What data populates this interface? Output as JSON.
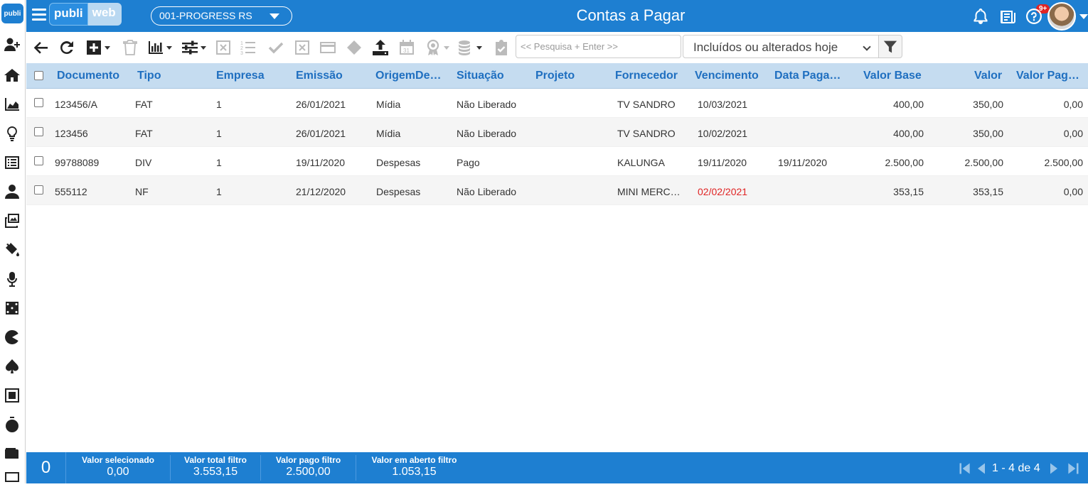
{
  "app": {
    "logo_mini": "publi",
    "brand_left": "publi",
    "brand_right": "web",
    "company": "001-PROGRESS RS",
    "title": "Contas a Pagar",
    "notification_badge": "9+"
  },
  "sidebar": {
    "items": [
      "add-user-icon",
      "home-icon",
      "chart-area-icon",
      "lightbulb-icon",
      "list-icon",
      "user-tie-icon",
      "photo-video-icon",
      "paint-bucket-icon",
      "microphone-icon",
      "dice-icon",
      "pacman-icon",
      "spade-icon",
      "square-icon",
      "stopwatch-icon",
      "wallet-icon",
      "monitor-icon"
    ]
  },
  "toolbar": {
    "search_placeholder": "<< Pesquisa + Enter >>",
    "filter_value": "Incluídos ou alterados hoje"
  },
  "table": {
    "columns": [
      "Documento",
      "Tipo",
      "Empresa",
      "Emissão",
      "OrigemDe…",
      "Situação",
      "Projeto",
      "Fornecedor",
      "Vencimento",
      "Data Paga…",
      "Valor Base",
      "Valor",
      "Valor Pag…"
    ],
    "rows": [
      {
        "documento": "123456/A",
        "tipo": "FAT",
        "empresa": "1",
        "emissao": "26/01/2021",
        "origem": "Mídia",
        "situacao": "Não Liberado",
        "projeto": "",
        "fornecedor": "TV SANDRO",
        "vencimento": "10/03/2021",
        "data_pagamento": "",
        "valor_base": "400,00",
        "valor": "350,00",
        "valor_pago": "0,00",
        "overdue": false
      },
      {
        "documento": "123456",
        "tipo": "FAT",
        "empresa": "1",
        "emissao": "26/01/2021",
        "origem": "Mídia",
        "situacao": "Não Liberado",
        "projeto": "",
        "fornecedor": "TV SANDRO",
        "vencimento": "10/02/2021",
        "data_pagamento": "",
        "valor_base": "400,00",
        "valor": "350,00",
        "valor_pago": "0,00",
        "overdue": false
      },
      {
        "documento": "99788089",
        "tipo": "DIV",
        "empresa": "1",
        "emissao": "19/11/2020",
        "origem": "Despesas",
        "situacao": "Pago",
        "projeto": "",
        "fornecedor": "KALUNGA",
        "vencimento": "19/11/2020",
        "data_pagamento": "19/11/2020",
        "valor_base": "2.500,00",
        "valor": "2.500,00",
        "valor_pago": "2.500,00",
        "overdue": false
      },
      {
        "documento": "555112",
        "tipo": "NF",
        "empresa": "1",
        "emissao": "21/12/2020",
        "origem": "Despesas",
        "situacao": "Não Liberado",
        "projeto": "",
        "fornecedor": "MINI MERC…",
        "vencimento": "02/02/2021",
        "data_pagamento": "",
        "valor_base": "353,15",
        "valor": "353,15",
        "valor_pago": "0,00",
        "overdue": true
      }
    ]
  },
  "footer": {
    "selected_count": "0",
    "stats": [
      {
        "label": "Valor selecionado",
        "value": "0,00"
      },
      {
        "label": "Valor total filtro",
        "value": "3.553,15"
      },
      {
        "label": "Valor pago filtro",
        "value": "2.500,00"
      },
      {
        "label": "Valor em aberto filtro",
        "value": "1.053,15"
      }
    ],
    "pager_text": "1 - 4 de 4"
  },
  "colors": {
    "primary": "#1e7fd1",
    "header_row": "#c5dcf0",
    "header_text": "#1f6fc0",
    "overdue": "#e02424"
  }
}
